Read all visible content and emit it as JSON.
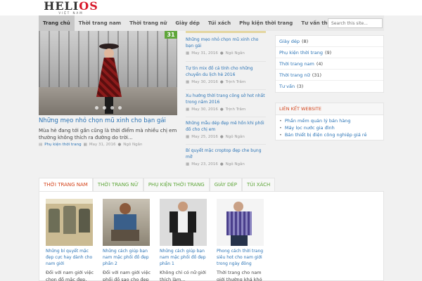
{
  "logo": {
    "main_a": "HELI",
    "main_b": "OS",
    "sub": "VIỆT NAM"
  },
  "nav": {
    "items": [
      "Trang chủ",
      "Thời trang nam",
      "Thời trang nữ",
      "Giày dép",
      "Túi xách",
      "Phụ kiện thời trang",
      "Tư vấn thời trang"
    ],
    "active_index": 0,
    "search_placeholder": "Search this site..."
  },
  "featured": {
    "badge": "31",
    "title": "Những mẹo nhỏ chọn mũ xinh cho bạn gái",
    "excerpt": "Mùa hè đang tới gần cũng là thời điểm mà nhiều chị em thường không thích ra đường do trời...",
    "category": "Phụ kiện thời trang",
    "date": "May 31, 2016",
    "author": "Ngô Ngân"
  },
  "posts": [
    {
      "title": "Những mẹo nhỏ chọn mũ xinh cho bạn gái",
      "date": "May 31, 2016",
      "author": "Ngô Ngân"
    },
    {
      "title": "Tự tin mix đồ cá tính cho những chuyến du lịch hè 2016",
      "date": "May 30, 2016",
      "author": "Trịnh Trâm"
    },
    {
      "title": "Xu hướng thời trang công sở hot nhất trong năm 2016",
      "date": "May 30, 2016",
      "author": "Trịnh Trâm"
    },
    {
      "title": "Những mẫu dép đẹp mê hồn khi phối đồ cho chị em",
      "date": "May 25, 2016",
      "author": "Ngô Ngân"
    },
    {
      "title": "Bí quyết mặc croptop đẹp che bụng mỡ",
      "date": "May 23, 2016",
      "author": "Ngô Ngân"
    }
  ],
  "sidebar": {
    "categories": [
      {
        "name": "Giày dép",
        "count": "(8)"
      },
      {
        "name": "Phụ kiện thời trang",
        "count": "(9)"
      },
      {
        "name": "Thời trang nam",
        "count": "(4)"
      },
      {
        "name": "Thời trang nữ",
        "count": "(31)"
      },
      {
        "name": "Tư vấn",
        "count": "(3)"
      }
    ],
    "links_header": "LIÊN KẾT WEBSITE",
    "links": [
      "Phần mềm quản lý bán hàng",
      "Máy lọc nước gia đình",
      "Bán thiết bị điện công nghiệp giá rẻ"
    ]
  },
  "tabs": {
    "items": [
      "THỜI TRANG NAM",
      "THỜI TRANG NỮ",
      "PHỤ KIỆN THỜI TRANG",
      "GIÀY DÉP",
      "TÚI XÁCH"
    ],
    "active_index": 0,
    "cards": [
      {
        "title": "Những bí quyết mặc đẹp cực hay dành cho nam giới",
        "excerpt": "Đối với nam giới việc chọn đồ mặc đẹp,"
      },
      {
        "title": "Những cách giúp bạn nam mặc phối đồ đẹp phần 2",
        "excerpt": "Đối với nam giới việc phối đồ sao cho đẹp"
      },
      {
        "title": "Những cách giúp bạn nam mặc phối đồ đẹp phần 1",
        "excerpt": "Không chỉ có nữ giới thích làm..."
      },
      {
        "title": "Phong cách thời trang siêu hot cho nam giới trong ngày đông",
        "excerpt": "Thời trang cho nam giới thường khá khó"
      }
    ]
  },
  "icons": {
    "calendar": "calendar-icon",
    "user": "user-icon",
    "folder": "folder-icon"
  },
  "colors": {
    "link": "#2a73b5",
    "badge": "#5fa63a",
    "heading_accent": "#d3431a",
    "logo_red": "#d8192b"
  }
}
